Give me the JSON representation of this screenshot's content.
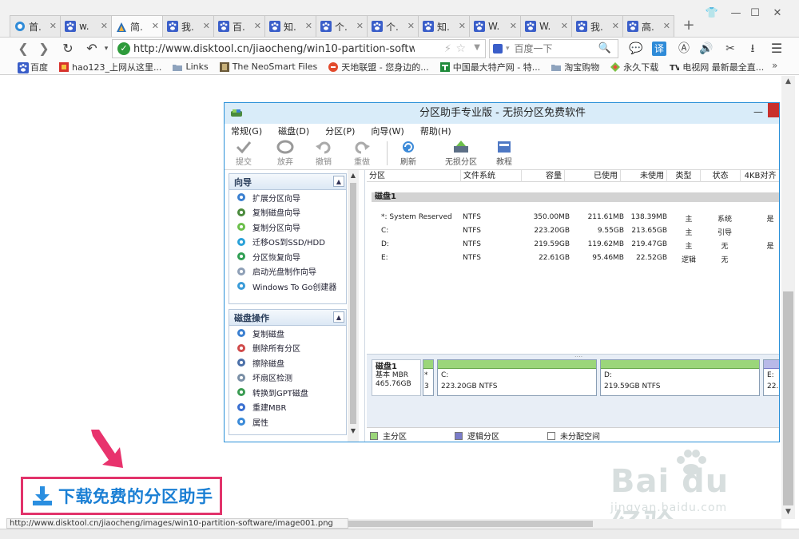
{
  "browser": {
    "tabs": [
      {
        "label": "首.",
        "icon": "ie-icon",
        "active": false
      },
      {
        "label": "w.",
        "icon": "paw-icon",
        "active": false
      },
      {
        "label": "简.",
        "icon": "triangle-icon",
        "active": true
      },
      {
        "label": "我.",
        "icon": "paw-icon",
        "active": false
      },
      {
        "label": "百.",
        "icon": "paw-icon",
        "active": false
      },
      {
        "label": "知.",
        "icon": "paw-icon",
        "active": false
      },
      {
        "label": "个.",
        "icon": "paw-icon",
        "active": false
      },
      {
        "label": "个.",
        "icon": "paw-icon",
        "active": false
      },
      {
        "label": "知.",
        "icon": "paw-icon",
        "active": false
      },
      {
        "label": "W.",
        "icon": "paw-icon",
        "active": false
      },
      {
        "label": "W.",
        "icon": "paw-icon",
        "active": false
      },
      {
        "label": "我.",
        "icon": "paw-icon",
        "active": false
      },
      {
        "label": "高.",
        "icon": "paw-icon",
        "active": false
      }
    ],
    "new_tab": "+",
    "url": "http://www.disktool.cn/jiaocheng/win10-partition-software.l",
    "search_placeholder": "百度一下",
    "translate_label": "译",
    "bookmarks": [
      {
        "label": "百度",
        "icon": "paw-icon"
      },
      {
        "label": "hao123_上网从这里...",
        "icon": "hao123-icon"
      },
      {
        "label": "Links",
        "icon": "folder-icon"
      },
      {
        "label": "The NeoSmart Files",
        "icon": "neosmart-icon"
      },
      {
        "label": "天地联盟 - 您身边的...",
        "icon": "tiandi-icon"
      },
      {
        "label": "中国最大特产网 - 特...",
        "icon": "tech-icon"
      },
      {
        "label": "淘宝购物",
        "icon": "folder-icon"
      },
      {
        "label": "永久下载",
        "icon": "download-site-icon"
      },
      {
        "label": "电视网 最新最全直...",
        "icon": "tv-icon"
      }
    ],
    "bookmarks_more": "»",
    "status_url": "http://www.disktool.cn/jiaocheng/images/win10-partition-software/image001.png"
  },
  "embedded_app": {
    "title": "分区助手专业版 - 无损分区免费软件",
    "menu": [
      "常规(G)",
      "磁盘(D)",
      "分区(P)",
      "向导(W)",
      "帮助(H)"
    ],
    "toolbar": [
      {
        "label": "提交",
        "enabled": false
      },
      {
        "label": "放弃",
        "enabled": false
      },
      {
        "label": "撤销",
        "enabled": false
      },
      {
        "label": "重做",
        "enabled": false
      },
      {
        "label": "刷新",
        "enabled": true
      },
      {
        "label": "无损分区",
        "enabled": true
      },
      {
        "label": "教程",
        "enabled": true
      }
    ],
    "wizard_panel": {
      "title": "向导",
      "items": [
        "扩展分区向导",
        "复制磁盘向导",
        "复制分区向导",
        "迁移OS到SSD/HDD",
        "分区恢复向导",
        "启动光盘制作向导",
        "Windows To Go创建器"
      ]
    },
    "disk_panel": {
      "title": "磁盘操作",
      "items": [
        "复制磁盘",
        "删除所有分区",
        "擦除磁盘",
        "坏扇区检测",
        "转换到GPT磁盘",
        "重建MBR",
        "属性"
      ]
    },
    "columns": [
      "分区",
      "文件系统",
      "容量",
      "已使用",
      "未使用",
      "类型",
      "状态",
      "4KB对齐"
    ],
    "disk_header": "磁盘1",
    "partitions": [
      {
        "name": "*: System Reserved",
        "fs": "NTFS",
        "capacity": "350.00MB",
        "used": "211.61MB",
        "free": "138.39MB",
        "type": "主",
        "status": "系统",
        "aligned": "是"
      },
      {
        "name": "C:",
        "fs": "NTFS",
        "capacity": "223.20GB",
        "used": "9.55GB",
        "free": "213.65GB",
        "type": "主",
        "status": "引导",
        "aligned": ""
      },
      {
        "name": "D:",
        "fs": "NTFS",
        "capacity": "219.59GB",
        "used": "119.62MB",
        "free": "219.47GB",
        "type": "主",
        "status": "无",
        "aligned": "是"
      },
      {
        "name": "E:",
        "fs": "NTFS",
        "capacity": "22.61GB",
        "used": "95.46MB",
        "free": "22.52GB",
        "type": "逻辑",
        "status": "无",
        "aligned": ""
      }
    ],
    "disk_card": {
      "name": "磁盘1",
      "style": "基本 MBR",
      "size": "465.76GB"
    },
    "visual_partitions": [
      {
        "top": "*",
        "bottom": "3",
        "kind": "primary"
      },
      {
        "top": "C:",
        "bottom": "223.20GB NTFS",
        "kind": "primary"
      },
      {
        "top": "D:",
        "bottom": "219.59GB NTFS",
        "kind": "primary"
      },
      {
        "top": "E:",
        "bottom": "22.",
        "kind": "logical"
      }
    ],
    "legend": [
      {
        "label": "主分区",
        "color": "#9bd67a"
      },
      {
        "label": "逻辑分区",
        "color": "#7a7cc9"
      },
      {
        "label": "未分配空间",
        "color": "#ffffff"
      }
    ]
  },
  "download_button": "下载免费的分区助手",
  "watermark": {
    "text": "Bai du 经验",
    "sub": "jingyan.baidu.com"
  },
  "colors": {
    "accent": "#1a7fd4",
    "highlight": "#e2336b",
    "titlebar": "#d9ecf9"
  }
}
